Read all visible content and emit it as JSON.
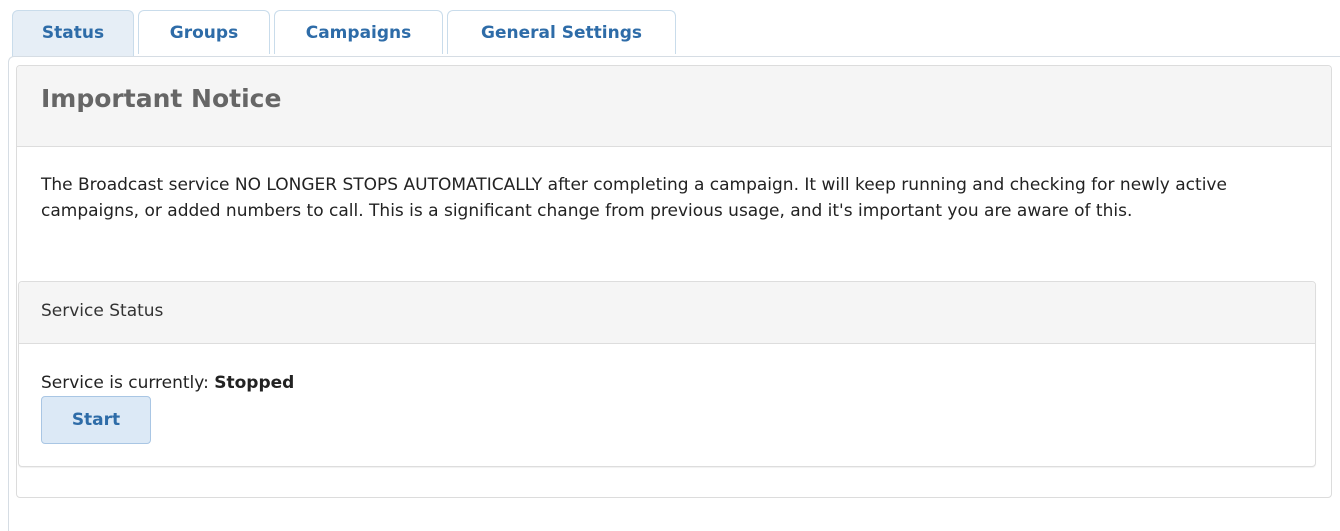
{
  "tabs": [
    {
      "label": "Status",
      "active": true
    },
    {
      "label": "Groups",
      "active": false
    },
    {
      "label": "Campaigns",
      "active": false
    },
    {
      "label": "General Settings",
      "active": false
    }
  ],
  "notice": {
    "title": "Important Notice",
    "body": "The Broadcast service NO LONGER STOPS AUTOMATICALLY after completing a campaign. It will keep running and checking for newly active campaigns, or added numbers to call. This is a significant change from previous usage, and it's important you are aware of this."
  },
  "service": {
    "heading": "Service Status",
    "status_prefix": "Service is currently: ",
    "status_value": "Stopped",
    "start_label": "Start"
  },
  "colors": {
    "tab_text": "#2e6ca8",
    "active_tab_bg": "#e6eef6",
    "button_bg": "#dce9f6",
    "panel_heading_bg": "#f5f5f5"
  }
}
